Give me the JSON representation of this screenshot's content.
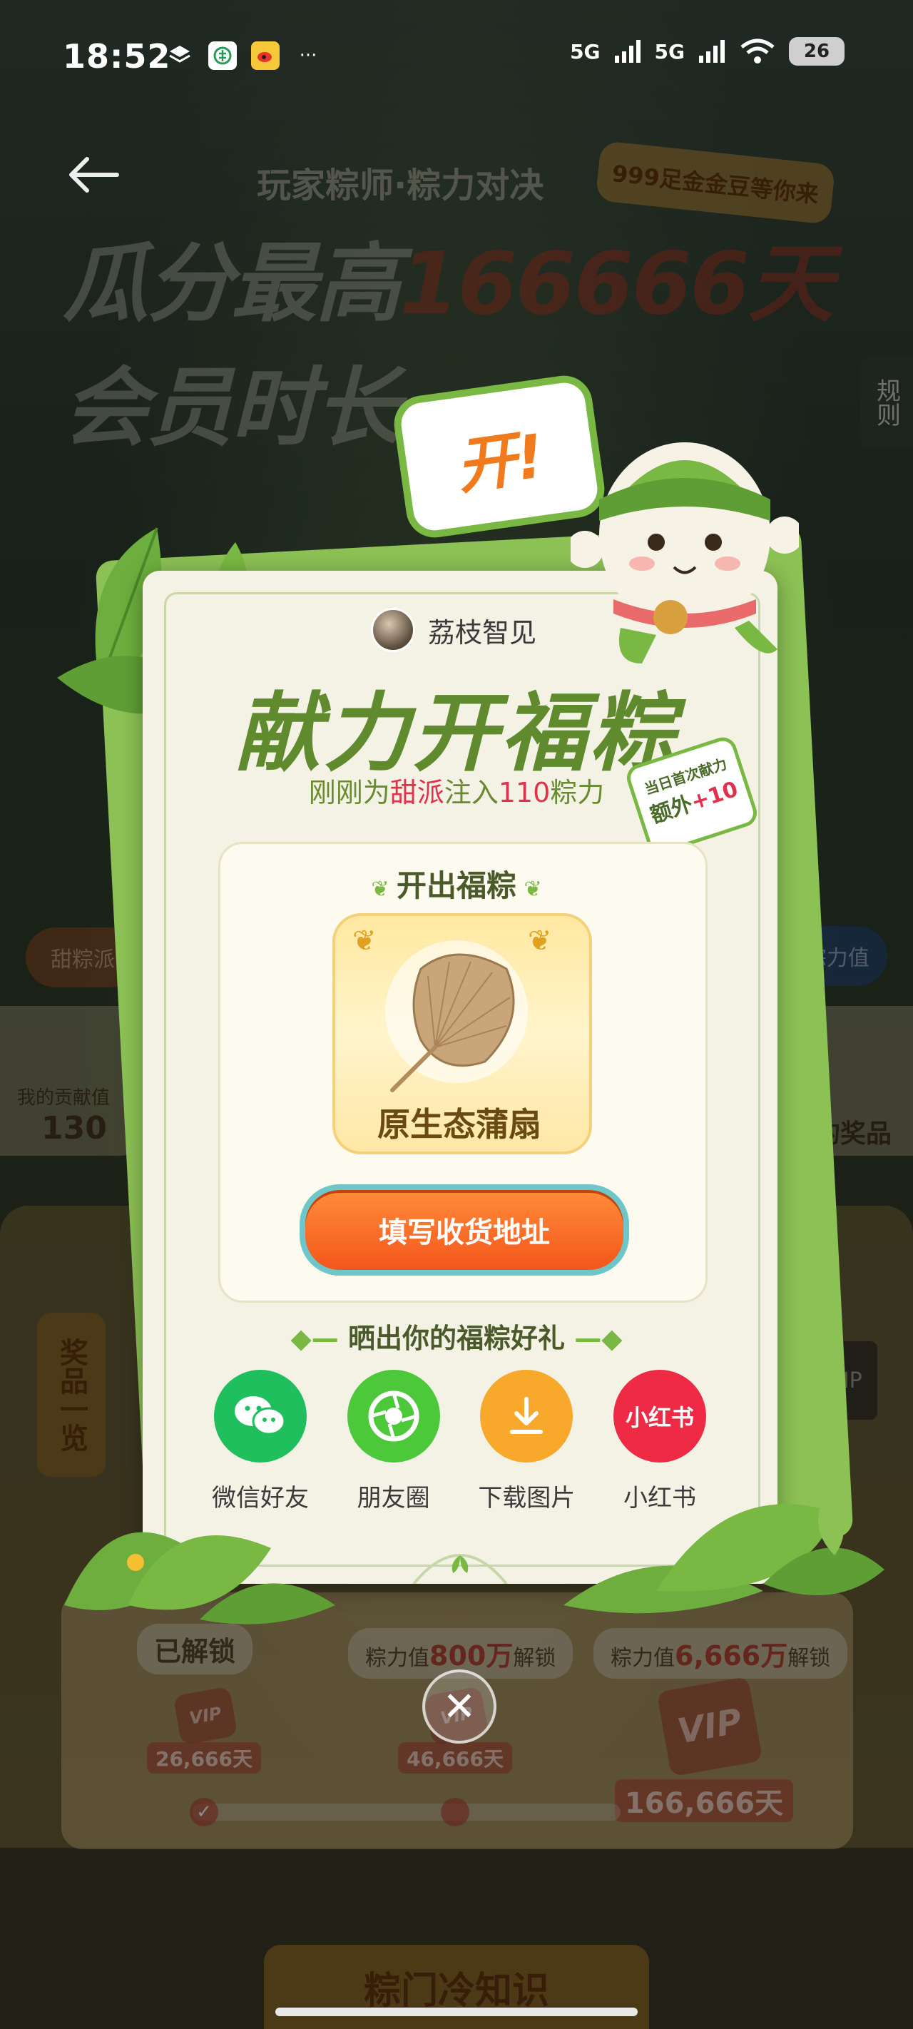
{
  "status_bar": {
    "time": "18:52",
    "signal1": "5G",
    "signal2": "5G",
    "battery": "26",
    "more": "···"
  },
  "background": {
    "banner_sub": "玩家粽师·粽力对决",
    "banner_tag": "999足金金豆等你来",
    "banner_main_prefix": "瓜分最高",
    "banner_main_number": "166666天",
    "banner_main_suffix": "会员时长",
    "rules": "规则",
    "chip_left": "甜粽派",
    "chip_right": "万 粽力值",
    "contribution_label": "我的贡献值",
    "contribution_value": "130",
    "my_prizes": "我的奖品",
    "prize_list_tab": "奖品一览",
    "vip_badge": "VIP",
    "stage1": "已解锁",
    "stage2_prefix": "粽力值",
    "stage2_num": "800万",
    "stage2_suffix": "解锁",
    "stage3_prefix": "粽力值",
    "stage3_num": "6,666万",
    "stage3_suffix": "解锁",
    "vip_label": "VIP",
    "days1": "26,666天",
    "days2": "46,666天",
    "days3": "166,666天",
    "knowledge_tab": "粽门冷知识"
  },
  "modal": {
    "open_bubble": "开!",
    "username": "荔枝智见",
    "title": "献力开福粽",
    "subtitle_prefix": "刚刚为",
    "subtitle_team": "甜派",
    "subtitle_mid": "注入",
    "subtitle_num": "110",
    "subtitle_suffix": "粽力",
    "bonus_line1": "当日首次献力",
    "bonus_line2": "额外",
    "bonus_value": "+10",
    "result_title": "开出福粽",
    "prize_name": "原生态蒲扇",
    "address_button": "填写收货地址",
    "share_title": "晒出你的福粽好礼",
    "share_items": [
      {
        "label": "微信好友",
        "icon": "wechat-icon",
        "color": "#1fbf5e"
      },
      {
        "label": "朋友圈",
        "icon": "moments-icon",
        "color": "#4cc83a"
      },
      {
        "label": "下载图片",
        "icon": "download-icon",
        "color": "#f8a82a"
      },
      {
        "label": "小红书",
        "icon_text": "小红书",
        "icon": "xiaohongshu-icon",
        "color": "#ee2a45"
      }
    ],
    "close_icon": "✕"
  },
  "colors": {
    "title_green": "#5f8a2e",
    "accent_red": "#e0334b",
    "button_orange": "#f4561c"
  }
}
